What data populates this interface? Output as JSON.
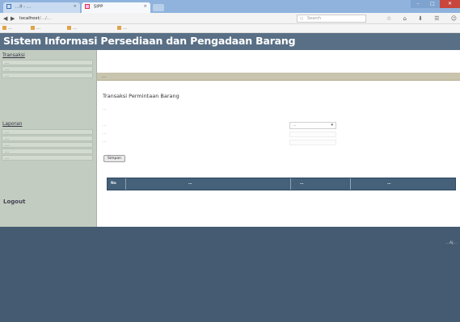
{
  "browser": {
    "tabs": [
      {
        "label": "…ll - …",
        "active": false
      },
      {
        "label": "SIPP",
        "active": true
      }
    ],
    "close_glyph": "×",
    "window_controls": {
      "minimize": "–",
      "maximize": "□",
      "close": "✕"
    },
    "nav": {
      "back": "◀",
      "forward": "▶"
    },
    "url_prefix": "localhost",
    "url_rest": "/…/…",
    "search_placeholder": "Search",
    "toolbar_icons": "☆ ⌂ ⬇ ☰ ☺",
    "bookmarks": [
      "…",
      "…",
      "…",
      "…"
    ]
  },
  "site": {
    "title": "Sistem Informasi Persediaan dan Pengadaan Barang",
    "brand_color": "#596f86"
  },
  "sidebar": {
    "section1_title": "Transaksi",
    "section1_items": [
      "…",
      "…",
      "…"
    ],
    "section2_title": "Laporan",
    "section2_items": [
      "…",
      "…",
      "…",
      "…",
      "…"
    ],
    "logout": "Logout"
  },
  "content": {
    "breadcrumb": "…",
    "heading": "Transaksi Permintaan Barang",
    "description": "…",
    "fields": [
      {
        "label": "…"
      },
      {
        "label": "…"
      },
      {
        "label": "…"
      }
    ],
    "select_value": "…",
    "select_caret": "▾",
    "submit_label": "Simpan",
    "table_headers": [
      "No",
      "…",
      "…",
      "…"
    ]
  },
  "footer": {
    "text": "…Aj…"
  }
}
